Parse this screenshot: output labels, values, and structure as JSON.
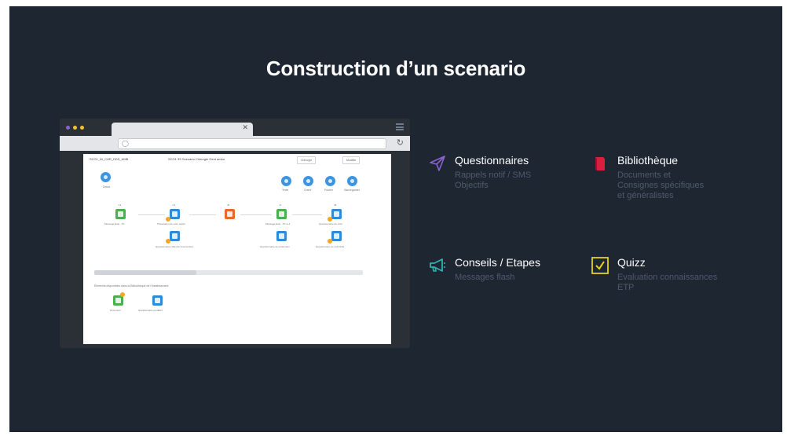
{
  "slide": {
    "title": "Construction d’un scenario"
  },
  "browser": {
    "screen": {
      "header_left": "SCO1_BI_CHR_DDS_AMB",
      "header_mid": "SCO1 3S Scenario Chirurgie Gent ambu",
      "header_select": "Chirurgie",
      "header_button": "Modifier",
      "start_label": "Debut",
      "actions": [
        "Texte",
        "Ouvrir",
        "Publier",
        "Sauvegarder"
      ],
      "nodes": [
        {
          "top": "J-3",
          "label": "Message Eval - TN"
        },
        {
          "top": "J-3",
          "label": "Préparation de votre séjour"
        },
        {
          "top": "J0",
          "label": ""
        },
        {
          "top": "J1",
          "label": "Message Eval - TN J+1"
        },
        {
          "top": "J8",
          "label": "Questionnaire de suivi"
        }
      ],
      "sub_nodes": [
        "Questionnaire l'effet de l'intervention",
        "Questionnaire de lendemain",
        "Questionnaire de suivi EVA"
      ],
      "library_label": "Éléments disponibles dans la Bibliothèque de l'établissement",
      "library_items": [
        "Document",
        "Questionnaire prédéfini"
      ]
    }
  },
  "features": [
    {
      "icon": "paper-plane-icon",
      "title": "Questionnaires",
      "desc": [
        "Rappels notif / SMS",
        "Objectifs"
      ]
    },
    {
      "icon": "book-icon",
      "title": "Bibliothèque",
      "desc": [
        "Documents et",
        "Consignes spécifiques",
        "et généralistes"
      ]
    },
    {
      "icon": "megaphone-icon",
      "title": "Conseils / Etapes",
      "desc": [
        "Messages flash"
      ]
    },
    {
      "icon": "checkbox-icon",
      "title": "Quizz",
      "desc": [
        "Evaluation connaissances",
        "ETP"
      ]
    }
  ],
  "colors": {
    "background": "#1e2632",
    "accent_purple": "#8a63d2",
    "accent_red": "#d81f3f",
    "accent_teal": "#2fb3b0",
    "accent_yellow": "#e8d21a",
    "desc_text": "#4e5a6a"
  }
}
